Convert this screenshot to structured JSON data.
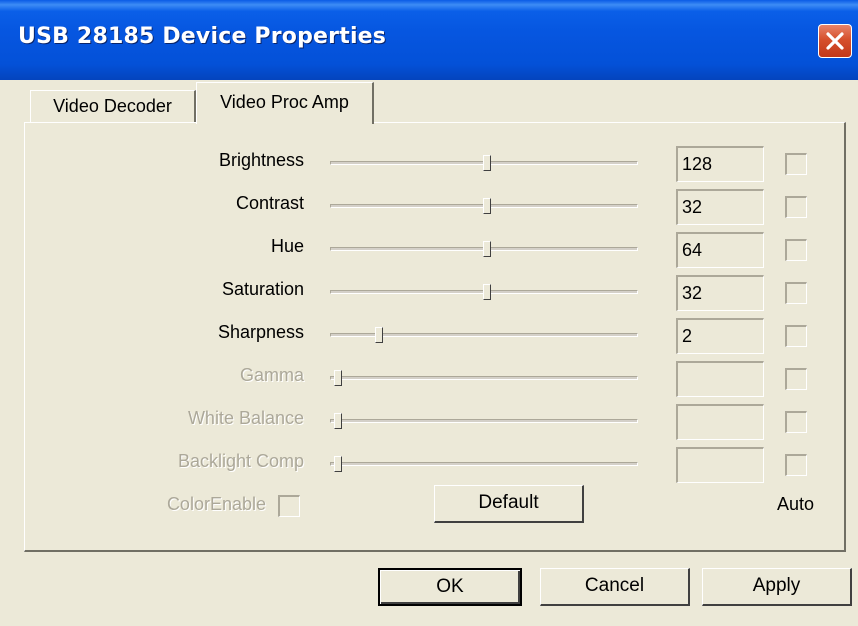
{
  "window": {
    "title": "USB 28185 Device Properties"
  },
  "tabs": [
    {
      "label": "Video Decoder"
    },
    {
      "label": "Video Proc Amp"
    }
  ],
  "controls": [
    {
      "label": "Brightness",
      "value": "128",
      "slider_fraction": 0.51,
      "enabled": true
    },
    {
      "label": "Contrast",
      "value": "32",
      "slider_fraction": 0.51,
      "enabled": true
    },
    {
      "label": "Hue",
      "value": "64",
      "slider_fraction": 0.51,
      "enabled": true
    },
    {
      "label": "Saturation",
      "value": "32",
      "slider_fraction": 0.51,
      "enabled": true
    },
    {
      "label": "Sharpness",
      "value": "2",
      "slider_fraction": 0.14,
      "enabled": true
    },
    {
      "label": "Gamma",
      "value": "",
      "slider_fraction": 0.0,
      "enabled": false
    },
    {
      "label": "White Balance",
      "value": "",
      "slider_fraction": 0.0,
      "enabled": false
    },
    {
      "label": "Backlight Comp",
      "value": "",
      "slider_fraction": 0.0,
      "enabled": false
    }
  ],
  "color_enable": {
    "label": "ColorEnable",
    "enabled": false
  },
  "default_button": "Default",
  "auto_label": "Auto",
  "buttons": {
    "ok": "OK",
    "cancel": "Cancel",
    "apply": "Apply"
  }
}
